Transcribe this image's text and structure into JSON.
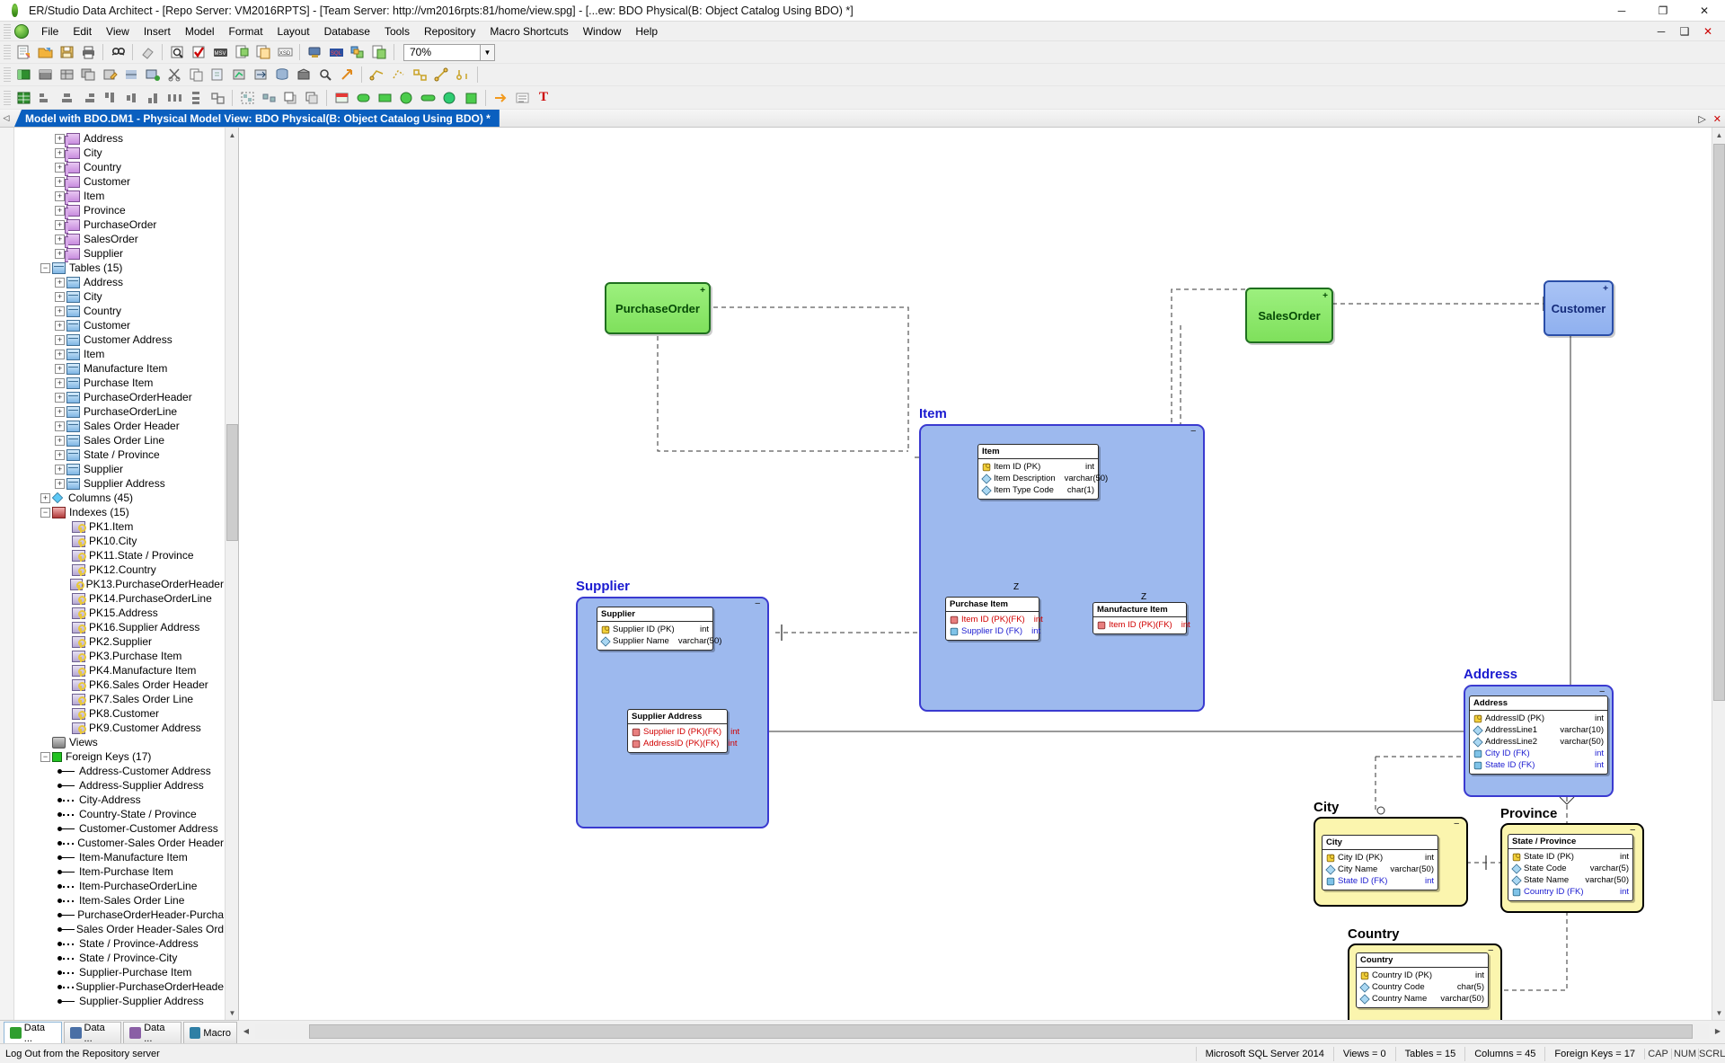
{
  "window": {
    "title": "ER/Studio Data Architect - [Repo Server: VM2016RPTS] - [Team Server: http://vm2016rpts:81/home/view.spg] - [...ew: BDO Physical(B: Object Catalog Using BDO) *]",
    "minimize": "─",
    "maximize": "❐",
    "close": "✕"
  },
  "menu": [
    {
      "label": "File"
    },
    {
      "label": "Edit"
    },
    {
      "label": "View"
    },
    {
      "label": "Insert"
    },
    {
      "label": "Model"
    },
    {
      "label": "Format"
    },
    {
      "label": "Layout"
    },
    {
      "label": "Database"
    },
    {
      "label": "Tools"
    },
    {
      "label": "Repository"
    },
    {
      "label": "Macro Shortcuts"
    },
    {
      "label": "Window"
    },
    {
      "label": "Help"
    }
  ],
  "toolbar": {
    "zoom_value": "70%",
    "icons_row1": [
      "new-document-icon",
      "open-folder-icon",
      "save-icon",
      "print-icon",
      "find-icon",
      "eraser-icon",
      "print-preview-icon",
      "validate-icon",
      "msv-icon",
      "export-document-icon",
      "copy-document-icon",
      "xsd-icon",
      "reverse-engineer-icon",
      "sql-icon",
      "compare-icon",
      "generate-icon"
    ],
    "icons_row2": [
      "entity-icon",
      "view-entity-icon",
      "table-icon",
      "table-group-icon",
      "table-edit-icon",
      "submodel-icon",
      "submodel-add-icon",
      "cut-tool-icon",
      "paste-list-icon",
      "attach-icon",
      "data-lineage-icon",
      "data-movement-icon",
      "data-source-icon",
      "data-warehouse-icon",
      "search-model-icon",
      "arrow-tool-icon",
      "relationship-id-icon",
      "relationship-nonid-icon",
      "relationship-many-icon",
      "relationship-recursive-icon",
      "relationship-view-icon"
    ],
    "icons_row3": [
      "grid-icon",
      "align-left-icon",
      "align-center-icon",
      "align-right-icon",
      "align-top-icon",
      "align-middle-icon",
      "align-bottom-icon",
      "space-h-icon",
      "space-v-icon",
      "size-icon",
      "group-icon",
      "ungroup-icon",
      "bring-front-icon",
      "send-back-icon",
      "lock-icon",
      "text-tool-icon"
    ],
    "color_swatches": [
      "#ff3b30",
      "#2ecc40",
      "#27ae60",
      "#3ddc84",
      "#2ecc71",
      "#16a34a"
    ],
    "text_tool_label": "T"
  },
  "doctab": {
    "nav_left": "◁",
    "title": "Model with BDO.DM1 - Physical Model View: BDO Physical(B: Object Catalog Using BDO) *",
    "nav_right": "▷",
    "close": "✕"
  },
  "sidebar": {
    "entities_visible": [
      "Address",
      "City",
      "Country",
      "Customer",
      "Item",
      "Province",
      "PurchaseOrder",
      "SalesOrder",
      "Supplier"
    ],
    "tables_group": "Tables (15)",
    "tables": [
      "Address",
      "City",
      "Country",
      "Customer",
      "Customer Address",
      "Item",
      "Manufacture Item",
      "Purchase Item",
      "PurchaseOrderHeader",
      "PurchaseOrderLine",
      "Sales Order Header",
      "Sales Order Line",
      "State / Province",
      "Supplier",
      "Supplier Address"
    ],
    "columns_group": "Columns (45)",
    "indexes_group": "Indexes (15)",
    "indexes": [
      "PK1.Item",
      "PK10.City",
      "PK11.State / Province",
      "PK12.Country",
      "PK13.PurchaseOrderHeader",
      "PK14.PurchaseOrderLine",
      "PK15.Address",
      "PK16.Supplier Address",
      "PK2.Supplier",
      "PK3.Purchase Item",
      "PK4.Manufacture Item",
      "PK6.Sales Order Header",
      "PK7.Sales Order Line",
      "PK8.Customer",
      "PK9.Customer Address"
    ],
    "views_group": "Views",
    "foreignkeys_group": "Foreign Keys (17)",
    "foreignkeys": [
      {
        "label": "Address-Customer Address",
        "style": "solid"
      },
      {
        "label": "Address-Supplier Address",
        "style": "solid"
      },
      {
        "label": "City-Address",
        "style": "dash"
      },
      {
        "label": "Country-State / Province",
        "style": "dash"
      },
      {
        "label": "Customer-Customer Address",
        "style": "solid"
      },
      {
        "label": "Customer-Sales Order Header",
        "style": "dash"
      },
      {
        "label": "Item-Manufacture Item",
        "style": "solid"
      },
      {
        "label": "Item-Purchase Item",
        "style": "solid"
      },
      {
        "label": "Item-PurchaseOrderLine",
        "style": "dash"
      },
      {
        "label": "Item-Sales Order Line",
        "style": "dash"
      },
      {
        "label": "PurchaseOrderHeader-Purcha",
        "style": "solid"
      },
      {
        "label": "Sales Order Header-Sales Ord",
        "style": "solid"
      },
      {
        "label": "State / Province-Address",
        "style": "dash"
      },
      {
        "label": "State / Province-City",
        "style": "dash"
      },
      {
        "label": "Supplier-Purchase Item",
        "style": "dash"
      },
      {
        "label": "Supplier-PurchaseOrderHeade",
        "style": "dash"
      },
      {
        "label": "Supplier-Supplier Address",
        "style": "solid"
      }
    ]
  },
  "diagram": {
    "subject_areas": [
      {
        "name": "Item",
        "color": "blue"
      },
      {
        "name": "Supplier",
        "color": "blue"
      },
      {
        "name": "Address",
        "color": "blue"
      },
      {
        "name": "City",
        "color": "yellow"
      },
      {
        "name": "Province",
        "color": "yellow"
      },
      {
        "name": "Country",
        "color": "yellow"
      }
    ],
    "collapsed_entities": [
      {
        "name": "PurchaseOrder",
        "color": "green",
        "expand": "+"
      },
      {
        "name": "SalesOrder",
        "color": "green",
        "expand": "+"
      },
      {
        "name": "Customer",
        "color": "blue",
        "expand": "+"
      }
    ],
    "entities": [
      {
        "name": "Item",
        "attributes": [
          {
            "name": "Item ID (PK)",
            "type": "int",
            "icon": "pk-key-icon",
            "cls": "pk"
          },
          {
            "name": "Item Description",
            "type": "varchar(50)",
            "icon": "attribute-icon",
            "cls": "pk"
          },
          {
            "name": "Item Type Code",
            "type": "char(1)",
            "icon": "attribute-icon",
            "cls": "pk"
          }
        ]
      },
      {
        "name": "Purchase Item",
        "attributes": [
          {
            "name": "Item ID (PK)(FK)",
            "type": "int",
            "icon": "pk-fk-icon",
            "cls": "pkfk"
          },
          {
            "name": "Supplier ID (FK)",
            "type": "int",
            "icon": "fk-icon",
            "cls": "fkc"
          }
        ]
      },
      {
        "name": "Manufacture Item",
        "attributes": [
          {
            "name": "Item ID (PK)(FK)",
            "type": "int",
            "icon": "pk-fk-icon",
            "cls": "pkfk"
          }
        ]
      },
      {
        "name": "Supplier",
        "attributes": [
          {
            "name": "Supplier ID (PK)",
            "type": "int",
            "icon": "pk-key-icon",
            "cls": "pk"
          },
          {
            "name": "Supplier Name",
            "type": "varchar(50)",
            "icon": "attribute-icon",
            "cls": "pk"
          }
        ]
      },
      {
        "name": "Supplier Address",
        "attributes": [
          {
            "name": "Supplier ID (PK)(FK)",
            "type": "int",
            "icon": "pk-fk-icon",
            "cls": "pkfk"
          },
          {
            "name": "AddressID (PK)(FK)",
            "type": "int",
            "icon": "pk-fk-icon",
            "cls": "pkfk"
          }
        ]
      },
      {
        "name": "Address",
        "attributes": [
          {
            "name": "AddressID (PK)",
            "type": "int",
            "icon": "pk-key-icon",
            "cls": "pk"
          },
          {
            "name": "AddressLine1",
            "type": "varchar(10)",
            "icon": "attribute-icon",
            "cls": "pk"
          },
          {
            "name": "AddressLine2",
            "type": "varchar(50)",
            "icon": "attribute-icon",
            "cls": "pk"
          },
          {
            "name": "City ID (FK)",
            "type": "int",
            "icon": "fk-icon",
            "cls": "fkc"
          },
          {
            "name": "State ID (FK)",
            "type": "int",
            "icon": "fk-icon",
            "cls": "fkc"
          }
        ]
      },
      {
        "name": "City",
        "attributes": [
          {
            "name": "City ID (PK)",
            "type": "int",
            "icon": "pk-key-icon",
            "cls": "pk"
          },
          {
            "name": "City Name",
            "type": "varchar(50)",
            "icon": "attribute-icon",
            "cls": "pk"
          },
          {
            "name": "State ID (FK)",
            "type": "int",
            "icon": "fk-icon",
            "cls": "fkc"
          }
        ]
      },
      {
        "name": "State / Province",
        "attributes": [
          {
            "name": "State ID (PK)",
            "type": "int",
            "icon": "pk-key-icon",
            "cls": "pk"
          },
          {
            "name": "State Code",
            "type": "varchar(5)",
            "icon": "attribute-icon",
            "cls": "pk"
          },
          {
            "name": "State Name",
            "type": "varchar(50)",
            "icon": "attribute-icon",
            "cls": "pk"
          },
          {
            "name": "Country ID (FK)",
            "type": "int",
            "icon": "fk-icon",
            "cls": "fkc"
          }
        ]
      },
      {
        "name": "Country",
        "attributes": [
          {
            "name": "Country ID (PK)",
            "type": "int",
            "icon": "pk-key-icon",
            "cls": "pk"
          },
          {
            "name": "Country Code",
            "type": "char(5)",
            "icon": "attribute-icon",
            "cls": "pk"
          },
          {
            "name": "Country Name",
            "type": "varchar(50)",
            "icon": "attribute-icon",
            "cls": "pk"
          }
        ]
      }
    ],
    "cardinality_labels": [
      "Z",
      "Z"
    ]
  },
  "bottom_tabs": [
    {
      "label": "Data ...",
      "active": true
    },
    {
      "label": "Data ...",
      "active": false
    },
    {
      "label": "Data ...",
      "active": false
    },
    {
      "label": "Macro",
      "active": false
    }
  ],
  "statusbar": {
    "message": "Log Out from the Repository server",
    "platform": "Microsoft SQL Server 2014",
    "views": "Views = 0",
    "tables": "Tables = 15",
    "columns": "Columns = 45",
    "foreign_keys": "Foreign Keys = 17",
    "cap": "CAP",
    "num": "NUM",
    "scrl": "SCRL"
  }
}
